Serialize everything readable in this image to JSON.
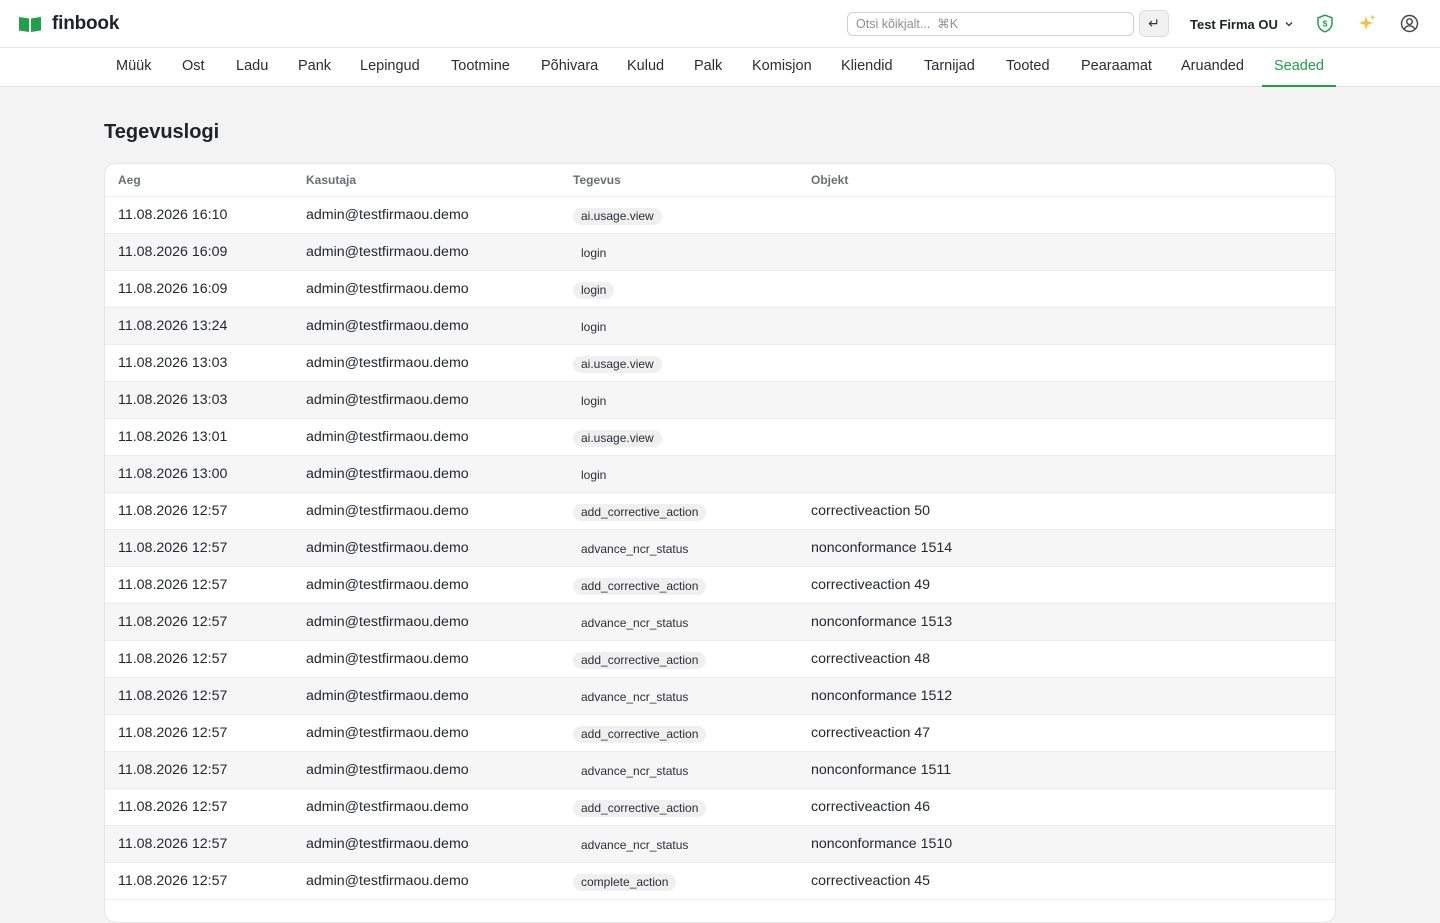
{
  "app": {
    "name": "finbook",
    "search_placeholder": "Otsi kõikjalt...  ⌘K",
    "enter_label": "↵",
    "company": "Test Firma OU",
    "brand_color": "#21a04a"
  },
  "icons": {
    "logo": "open-book-icon",
    "shield": "shield-dollar-icon",
    "sparkle": "sparkle-icon",
    "user": "user-circle-icon",
    "chevron": "chevron-down-icon"
  },
  "nav": [
    {
      "label": "Müük"
    },
    {
      "label": "Ost"
    },
    {
      "label": "Ladu"
    },
    {
      "label": "Pank"
    },
    {
      "label": "Lepingud"
    },
    {
      "label": "Tootmine"
    },
    {
      "label": "Põhivara"
    },
    {
      "label": "Kulud"
    },
    {
      "label": "Palk"
    },
    {
      "label": "Komisjon"
    },
    {
      "label": "Kliendid"
    },
    {
      "label": "Tarnijad"
    },
    {
      "label": "Tooted"
    },
    {
      "label": "Pearaamat"
    },
    {
      "label": "Aruanded"
    },
    {
      "label": "Seaded",
      "active": true
    }
  ],
  "page": {
    "title": "Tegevuslogi"
  },
  "table": {
    "columns": [
      "Aeg",
      "Kasutaja",
      "Tegevus",
      "Objekt"
    ],
    "rows": [
      [
        "11.08.2026 16:10",
        "admin@testfirmaou.demo",
        "ai.usage.view",
        ""
      ],
      [
        "11.08.2026 16:09",
        "admin@testfirmaou.demo",
        "login",
        ""
      ],
      [
        "11.08.2026 16:09",
        "admin@testfirmaou.demo",
        "login",
        ""
      ],
      [
        "11.08.2026 13:24",
        "admin@testfirmaou.demo",
        "login",
        ""
      ],
      [
        "11.08.2026 13:03",
        "admin@testfirmaou.demo",
        "ai.usage.view",
        ""
      ],
      [
        "11.08.2026 13:03",
        "admin@testfirmaou.demo",
        "login",
        ""
      ],
      [
        "11.08.2026 13:01",
        "admin@testfirmaou.demo",
        "ai.usage.view",
        ""
      ],
      [
        "11.08.2026 13:00",
        "admin@testfirmaou.demo",
        "login",
        ""
      ],
      [
        "11.08.2026 12:57",
        "admin@testfirmaou.demo",
        "add_corrective_action",
        "correctiveaction 50"
      ],
      [
        "11.08.2026 12:57",
        "admin@testfirmaou.demo",
        "advance_ncr_status",
        "nonconformance 1514"
      ],
      [
        "11.08.2026 12:57",
        "admin@testfirmaou.demo",
        "add_corrective_action",
        "correctiveaction 49"
      ],
      [
        "11.08.2026 12:57",
        "admin@testfirmaou.demo",
        "advance_ncr_status",
        "nonconformance 1513"
      ],
      [
        "11.08.2026 12:57",
        "admin@testfirmaou.demo",
        "add_corrective_action",
        "correctiveaction 48"
      ],
      [
        "11.08.2026 12:57",
        "admin@testfirmaou.demo",
        "advance_ncr_status",
        "nonconformance 1512"
      ],
      [
        "11.08.2026 12:57",
        "admin@testfirmaou.demo",
        "add_corrective_action",
        "correctiveaction 47"
      ],
      [
        "11.08.2026 12:57",
        "admin@testfirmaou.demo",
        "advance_ncr_status",
        "nonconformance 1511"
      ],
      [
        "11.08.2026 12:57",
        "admin@testfirmaou.demo",
        "add_corrective_action",
        "correctiveaction 46"
      ],
      [
        "11.08.2026 12:57",
        "admin@testfirmaou.demo",
        "advance_ncr_status",
        "nonconformance 1510"
      ],
      [
        "11.08.2026 12:57",
        "admin@testfirmaou.demo",
        "complete_action",
        "correctiveaction 45"
      ]
    ]
  }
}
